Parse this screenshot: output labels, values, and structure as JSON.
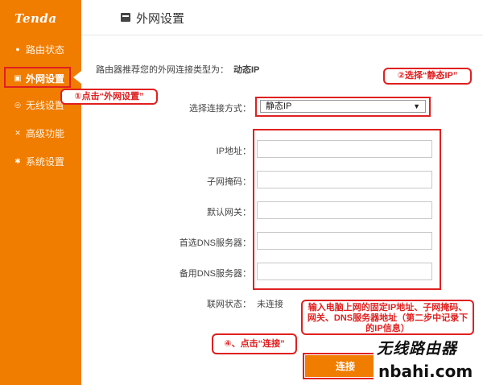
{
  "app": {
    "logo": "Tenda"
  },
  "sidebar": {
    "items": [
      {
        "label": "路由状态",
        "icon": "circle-icon"
      },
      {
        "label": "外网设置",
        "icon": "network-card-icon",
        "active": true
      },
      {
        "label": "无线设置",
        "icon": "wifi-icon"
      },
      {
        "label": "高级功能",
        "icon": "tools-icon"
      },
      {
        "label": "系统设置",
        "icon": "gear-icon"
      }
    ]
  },
  "header": {
    "title": "外网设置",
    "icon": "network-card-icon"
  },
  "main": {
    "detect": {
      "label": "路由器推荐您的外网连接类型为：",
      "value": "动态IP"
    },
    "connection_mode": {
      "label": "选择连接方式：",
      "selected": "静态IP",
      "arrow": "▼"
    },
    "fields": [
      {
        "label": "IP地址：",
        "value": ""
      },
      {
        "label": "子网掩码：",
        "value": ""
      },
      {
        "label": "默认网关：",
        "value": ""
      },
      {
        "label": "首选DNS服务器：",
        "value": ""
      },
      {
        "label": "备用DNS服务器：",
        "value": ""
      }
    ],
    "status": {
      "label": "联网状态：",
      "value": "未连接"
    },
    "connect_button": "连接"
  },
  "annotations": {
    "step1": "①点击“外网设置”",
    "step2": "②选择“静态IP”",
    "step3": "输入电脑上网的固定IP地址、子网掩码、网关、DNS服务器地址（第二步中记录下的IP信息）",
    "step4": "④、点击“连接”"
  },
  "watermark": {
    "title": "无线路由器",
    "domain": "nbahi.com"
  },
  "colors": {
    "brand": "#f07c00",
    "annotation": "#e02020"
  }
}
